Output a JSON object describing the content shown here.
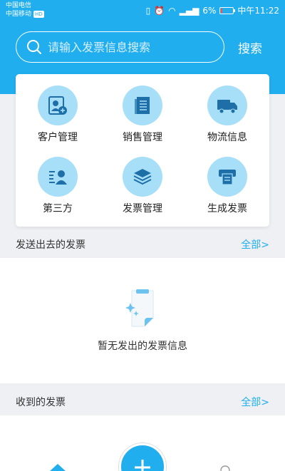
{
  "status_bar": {
    "carrier1": "中国电信",
    "carrier2": "中国移动",
    "hd": "HD",
    "battery": "6%",
    "time": "中午11:22"
  },
  "search": {
    "placeholder": "请输入发票信息搜索",
    "button_label": "搜索"
  },
  "menu": {
    "items": [
      {
        "label": "客户管理",
        "icon": "customer-add-icon"
      },
      {
        "label": "销售管理",
        "icon": "document-list-icon"
      },
      {
        "label": "物流信息",
        "icon": "truck-icon"
      },
      {
        "label": "第三方",
        "icon": "third-party-user-icon"
      },
      {
        "label": "发票管理",
        "icon": "stack-layers-icon"
      },
      {
        "label": "生成发票",
        "icon": "printer-icon"
      }
    ]
  },
  "sent_section": {
    "title": "发送出去的发票",
    "more": "全部>",
    "empty_text": "暂无发出的发票信息"
  },
  "received_section": {
    "title": "收到的发票",
    "more": "全部>"
  },
  "colors": {
    "primary": "#21aeee",
    "icon_bg": "#a7dff8",
    "icon_fg": "#1e6fa8",
    "page_bg": "#eef0f3"
  }
}
